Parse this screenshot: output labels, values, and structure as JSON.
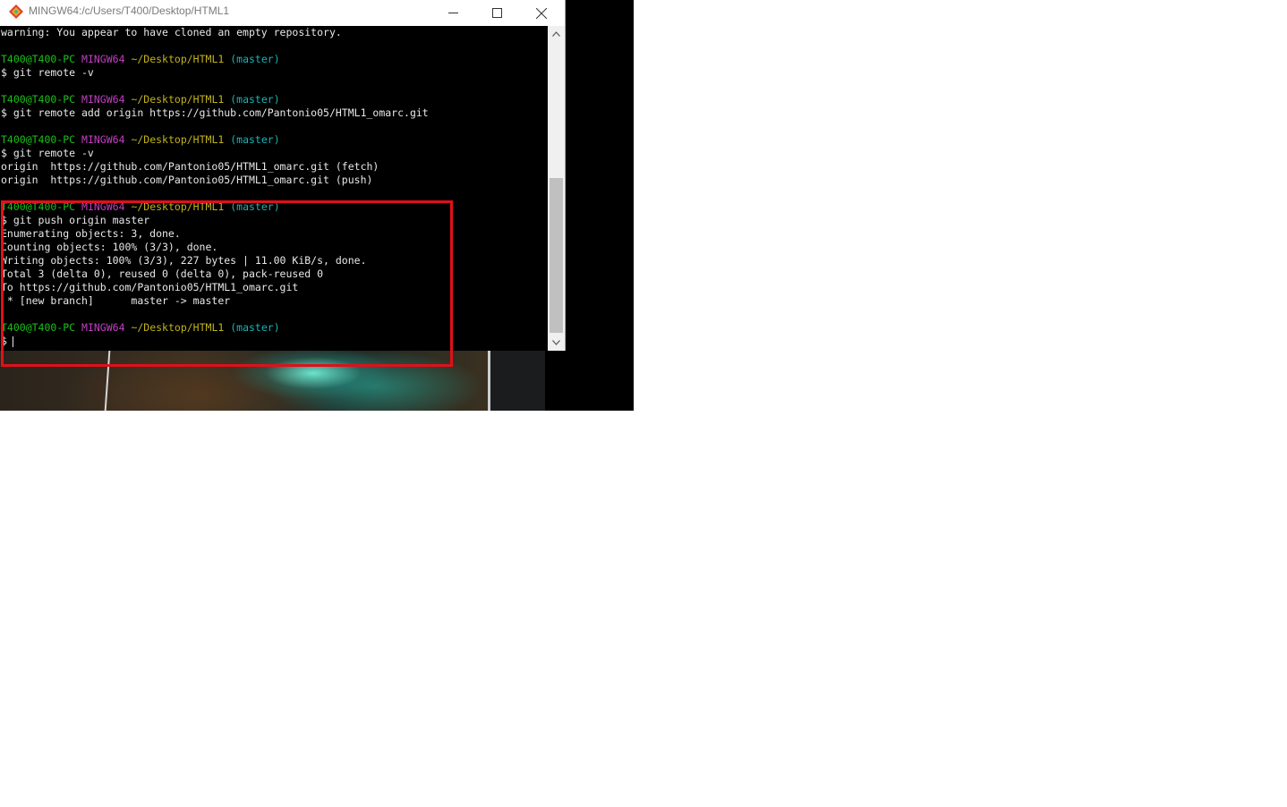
{
  "window": {
    "title": "MINGW64:/c/Users/T400/Desktop/HTML1",
    "icon": "git-bash-icon",
    "controls": [
      "minimize-icon",
      "maximize-icon",
      "close-icon"
    ]
  },
  "terminal": {
    "lines": [
      {
        "type": "text",
        "text": "warning: You appear to have cloned an empty repository."
      },
      {
        "type": "blank"
      },
      {
        "type": "prompt",
        "user": "T400@T400-PC",
        "msys": "MINGW64",
        "path": "~/Desktop/HTML1",
        "branch": "(master)"
      },
      {
        "type": "text",
        "text": "$ git remote -v"
      },
      {
        "type": "blank"
      },
      {
        "type": "prompt",
        "user": "T400@T400-PC",
        "msys": "MINGW64",
        "path": "~/Desktop/HTML1",
        "branch": "(master)"
      },
      {
        "type": "text",
        "text": "$ git remote add origin https://github.com/Pantonio05/HTML1_omarc.git"
      },
      {
        "type": "blank"
      },
      {
        "type": "prompt",
        "user": "T400@T400-PC",
        "msys": "MINGW64",
        "path": "~/Desktop/HTML1",
        "branch": "(master)"
      },
      {
        "type": "text",
        "text": "$ git remote -v"
      },
      {
        "type": "text",
        "text": "origin  https://github.com/Pantonio05/HTML1_omarc.git (fetch)"
      },
      {
        "type": "text",
        "text": "origin  https://github.com/Pantonio05/HTML1_omarc.git (push)"
      },
      {
        "type": "blank"
      },
      {
        "type": "prompt",
        "user": "T400@T400-PC",
        "msys": "MINGW64",
        "path": "~/Desktop/HTML1",
        "branch": "(master)"
      },
      {
        "type": "text",
        "text": "$ git push origin master"
      },
      {
        "type": "text",
        "text": "Enumerating objects: 3, done."
      },
      {
        "type": "text",
        "text": "Counting objects: 100% (3/3), done."
      },
      {
        "type": "text",
        "text": "Writing objects: 100% (3/3), 227 bytes | 11.00 KiB/s, done."
      },
      {
        "type": "text",
        "text": "Total 3 (delta 0), reused 0 (delta 0), pack-reused 0"
      },
      {
        "type": "text",
        "text": "To https://github.com/Pantonio05/HTML1_omarc.git"
      },
      {
        "type": "text",
        "text": " * [new branch]      master -> master"
      },
      {
        "type": "blank"
      },
      {
        "type": "prompt",
        "user": "T400@T400-PC",
        "msys": "MINGW64",
        "path": "~/Desktop/HTML1",
        "branch": "(master)"
      },
      {
        "type": "input",
        "text": "$"
      }
    ]
  },
  "colors": {
    "user": "#19c219",
    "msys": "#c23fc2",
    "path": "#c2b31a",
    "branch": "#19b5b5",
    "highlight": "#e0101a"
  }
}
